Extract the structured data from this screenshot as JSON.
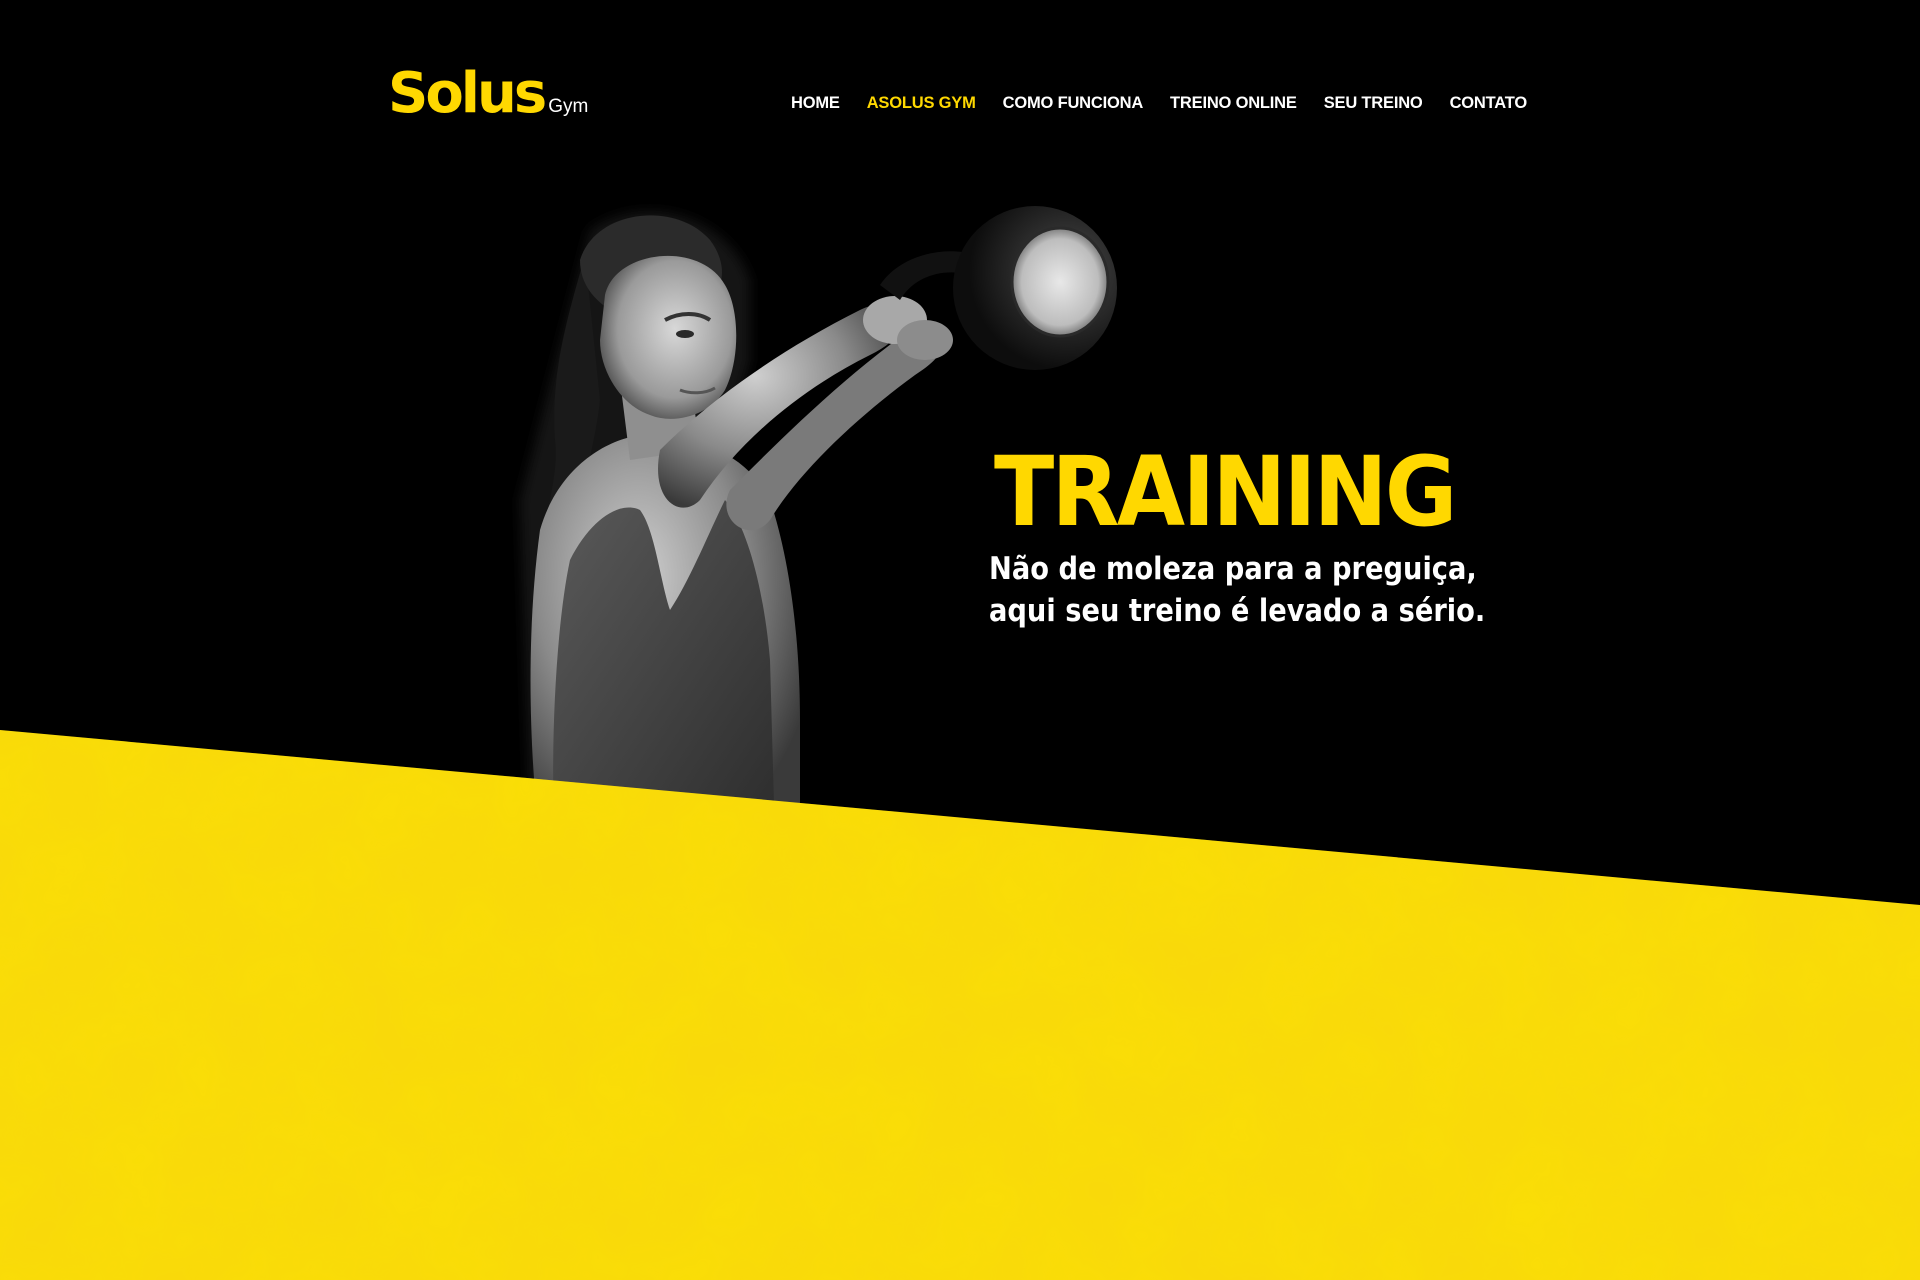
{
  "brand": {
    "name": "Solus",
    "suffix": "Gym",
    "accent_color": "#FFD800",
    "band_color": "#F9D90A"
  },
  "nav": {
    "items": [
      {
        "label": "HOME",
        "active": false
      },
      {
        "label": "ASOLUS GYM",
        "active": true
      },
      {
        "label": "COMO FUNCIONA",
        "active": false
      },
      {
        "label": "TREINO ONLINE",
        "active": false
      },
      {
        "label": "SEU TREINO",
        "active": false
      },
      {
        "label": "CONTATO",
        "active": false
      }
    ]
  },
  "hero": {
    "title": "TRAINING",
    "subtitle_line1": "Não de moleza para a preguiça,",
    "subtitle_line2": "aqui seu treino é levado a sério.",
    "image": "woman-swinging-kettlebell-photo"
  }
}
